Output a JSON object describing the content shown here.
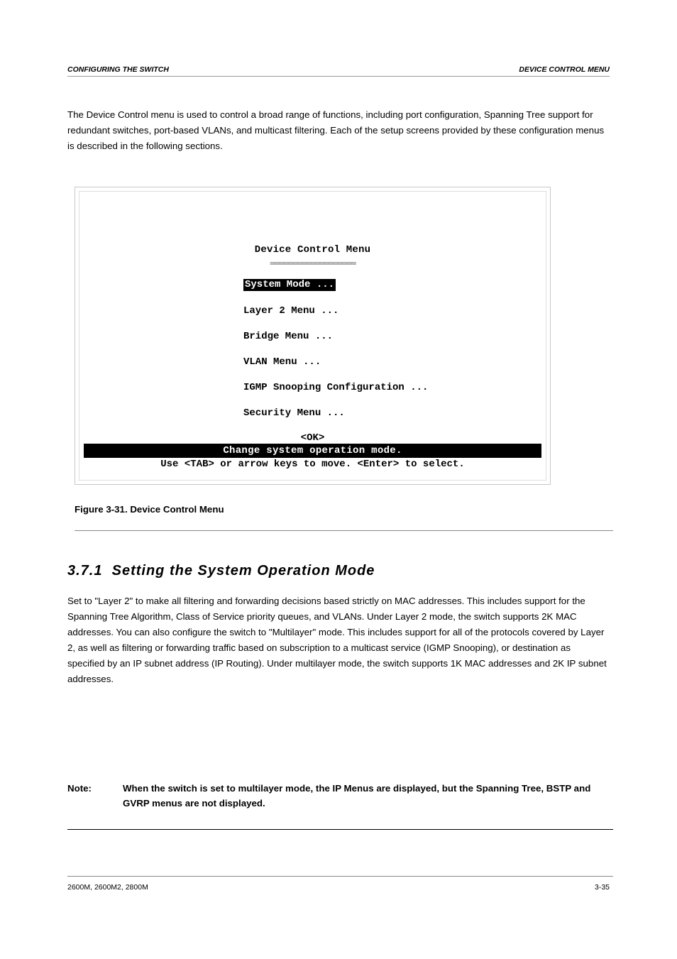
{
  "header": {
    "left": "C",
    "left_suffix": "ONFIGURING THE ",
    "left_bold2": "S",
    "left_suffix2": "WITCH",
    "right": "D",
    "right_suffix": "EVICE ",
    "right_bold2": "C",
    "right_suffix2": "ONTROL ",
    "right_bold3": "M",
    "right_suffix3": "ENU"
  },
  "para1": "The Device Control menu is used to control a broad range of functions, including port configuration, Spanning Tree support for redundant switches, port-based VLANs, and multicast filtering. Each of the setup screens provided by these configuration menus is described in the following sections.",
  "figure_text": {
    "title": "Device Control Menu",
    "underline": "═══════════════════",
    "items": [
      "System Mode ...",
      "Layer 2 Menu ...",
      "Bridge Menu ...",
      "VLAN Menu ...",
      "IGMP Snooping Configuration ...",
      "Security Menu ..."
    ],
    "ok": "<OK>",
    "status": "Change system operation mode.",
    "hint": "Use <TAB> or arrow keys to move. <Enter> to select."
  },
  "figure_label": "Figure 3-31. Device Control Menu",
  "section": {
    "num": "3.7.1",
    "title": "Setting the System Operation Mode"
  },
  "para2": "Set to \"Layer 2\" to make all filtering and forwarding decisions based strictly on MAC addresses. This includes support for the Spanning Tree Algorithm, Class of Service priority queues, and VLANs. Under Layer 2 mode, the switch supports 2K MAC addresses. You can also configure the switch to \"Multilayer\" mode. This includes support for all of the protocols covered by Layer 2, as well as filtering or forwarding traffic based on subscription to a multicast service (IGMP Snooping), or destination as specified by an IP subnet address (IP Routing). Under multilayer mode, the switch supports 1K MAC addresses and 2K IP subnet addresses.",
  "note": {
    "label": "Note:",
    "body": "When the switch is set to multilayer mode, the IP Menus are displayed, but the Spanning Tree, BSTP and GVRP menus are not displayed."
  },
  "footer": {
    "left": "2600M, 2600M2, 2800M",
    "right": "3-35"
  }
}
